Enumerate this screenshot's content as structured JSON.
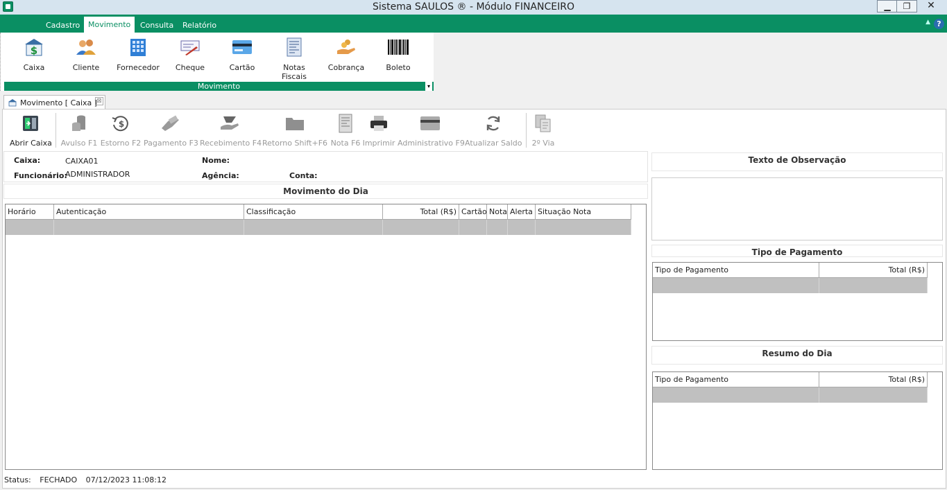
{
  "window": {
    "title": "Sistema SAULOS ® - Módulo FINANCEIRO",
    "min": "▁",
    "max": "❐",
    "close": "✕"
  },
  "ribbon": {
    "tabs": [
      "Cadastro",
      "Movimento",
      "Consulta",
      "Relatório"
    ],
    "active_tab": "Movimento",
    "help": "?",
    "collapse": "▲",
    "buttons": [
      {
        "label": "Caixa",
        "icon": "cash-register-icon"
      },
      {
        "label": "Cliente",
        "icon": "users-icon"
      },
      {
        "label": "Fornecedor",
        "icon": "building-icon"
      },
      {
        "label": "Cheque",
        "icon": "check-pen-icon"
      },
      {
        "label": "Cartão",
        "icon": "credit-card-icon"
      },
      {
        "label": "Notas Fiscais",
        "icon": "invoice-icon"
      },
      {
        "label": "Cobrança",
        "icon": "hand-coins-icon"
      },
      {
        "label": "Boleto",
        "icon": "barcode-icon"
      }
    ],
    "group_label": "Movimento",
    "group_arrow": "▾"
  },
  "doc_tab": {
    "label": "Movimento [ Caixa ]",
    "close": "⊠"
  },
  "toolbar": {
    "items": [
      {
        "label": "Abrir Caixa",
        "enabled": true
      },
      {
        "label": "Avulso F1",
        "enabled": false
      },
      {
        "label": "Estorno F2",
        "enabled": false
      },
      {
        "label": "Pagamento F3",
        "enabled": false
      },
      {
        "label": "Recebimento F4",
        "enabled": false
      },
      {
        "label": "Retorno Shift+F6",
        "enabled": false
      },
      {
        "label": "Nota F6",
        "enabled": false
      },
      {
        "label": "Imprimir",
        "enabled": false
      },
      {
        "label": "Administrativo F9",
        "enabled": false
      },
      {
        "label": "Atualizar Saldo",
        "enabled": false
      },
      {
        "label": "2º Via",
        "enabled": false
      }
    ]
  },
  "info": {
    "caixa_label": "Caixa:",
    "caixa_value": "CAIXA01",
    "funcionario_label": "Funcionário:",
    "funcionario_value": "ADMINISTRADOR",
    "nome_label": "Nome:",
    "agencia_label": "Agência:",
    "conta_label": "Conta:"
  },
  "movimento": {
    "title": "Movimento do Dia",
    "columns": [
      "Horário",
      "Autenticação",
      "Classificação",
      "Total (R$)",
      "Cartão",
      "Nota",
      "Alerta",
      "Situação Nota"
    ]
  },
  "observacao": {
    "title": "Texto de Observação"
  },
  "tipo_pagamento": {
    "title": "Tipo de Pagamento",
    "columns": [
      "Tipo de Pagamento",
      "Total (R$)"
    ]
  },
  "resumo": {
    "title": "Resumo do Dia",
    "columns": [
      "Tipo de Pagamento",
      "Total (R$)"
    ]
  },
  "status": {
    "label": "Status:",
    "value": "FECHADO",
    "datetime": "07/12/2023 11:08:12"
  }
}
